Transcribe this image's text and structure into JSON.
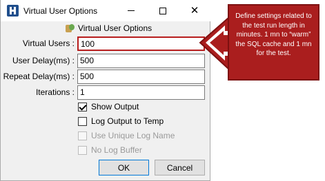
{
  "window": {
    "title": "Virtual User Options",
    "controls": {
      "minimize": "—",
      "maximize": "□",
      "close": "✕"
    },
    "icon": "hammerdb-app-icon"
  },
  "header": {
    "title": "Virtual User Options",
    "icon": "users-icon"
  },
  "fields": [
    {
      "label": "Virtual Users :",
      "value": "100"
    },
    {
      "label": "User Delay(ms) :",
      "value": "500"
    },
    {
      "label": "Repeat Delay(ms) :",
      "value": "500"
    },
    {
      "label": "Iterations :",
      "value": "1"
    }
  ],
  "options": [
    {
      "label": "Show Output",
      "checked": true,
      "enabled": true
    },
    {
      "label": "Log Output to Temp",
      "checked": false,
      "enabled": true
    },
    {
      "label": "Use Unique Log Name",
      "checked": false,
      "enabled": false
    },
    {
      "label": "No Log Buffer",
      "checked": false,
      "enabled": false
    }
  ],
  "buttons": {
    "ok": "OK",
    "cancel": "Cancel"
  },
  "callout": {
    "text": "Define settings related to the test run length in minutes. 1 mn to “warm” the SQL cache and 1 mn for the test.",
    "color": "#aa1e1e"
  }
}
